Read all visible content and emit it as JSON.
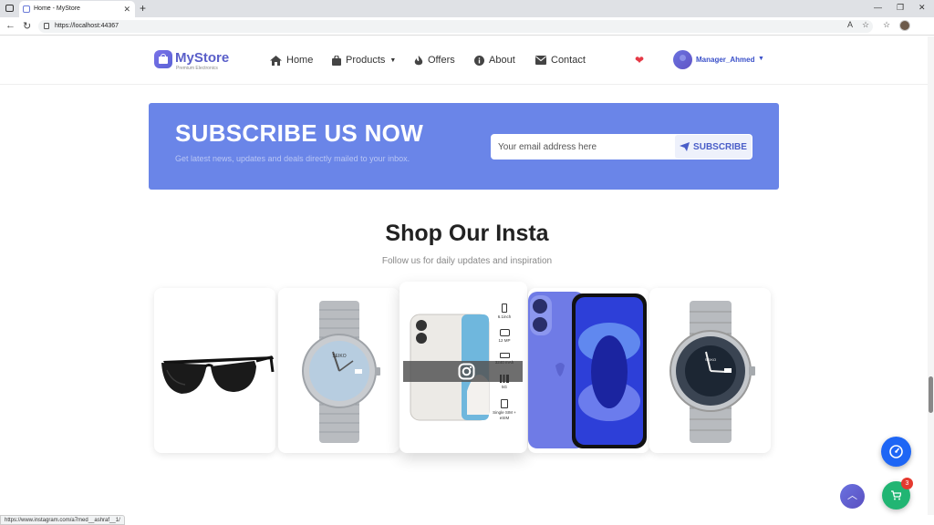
{
  "browser": {
    "tab_title": "Home - MyStore",
    "url": "https://localhost:44367",
    "new_tab": "+",
    "tab_close": "✕"
  },
  "site": {
    "logo": "MyStore",
    "tagline": "Premium Electronics",
    "nav": [
      {
        "label": "Home",
        "icon": "home-icon"
      },
      {
        "label": "Products",
        "icon": "bag-icon",
        "dropdown": true
      },
      {
        "label": "Offers",
        "icon": "fire-icon"
      },
      {
        "label": "About",
        "icon": "info-icon"
      },
      {
        "label": "Contact",
        "icon": "envelope-icon"
      }
    ],
    "user": "Manager_Ahmed"
  },
  "subscribe": {
    "title": "SUBSCRIBE US NOW",
    "description": "Get latest news, updates and deals directly mailed to your inbox.",
    "email_placeholder": "Your email address here",
    "button_label": "SUBSCRIBE"
  },
  "insta": {
    "title": "Shop Our Insta",
    "subtitle": "Follow us for daily updates and inspiration",
    "phone_specs": [
      "6.1inch",
      "12 MP",
      "3240 mAh",
      "5G",
      "Single SIM + eSIM"
    ],
    "watch_brand": "SEIKO"
  },
  "floating": {
    "cart_count": "3"
  },
  "statusbar": {
    "link": "https://www.instagram.com/a7med__ashraf__1/"
  },
  "colors": {
    "brand": "#5a5fc9",
    "subscribe_bg": "#6a85e8",
    "cart_fab": "#21b573",
    "badge": "#e5392f"
  }
}
